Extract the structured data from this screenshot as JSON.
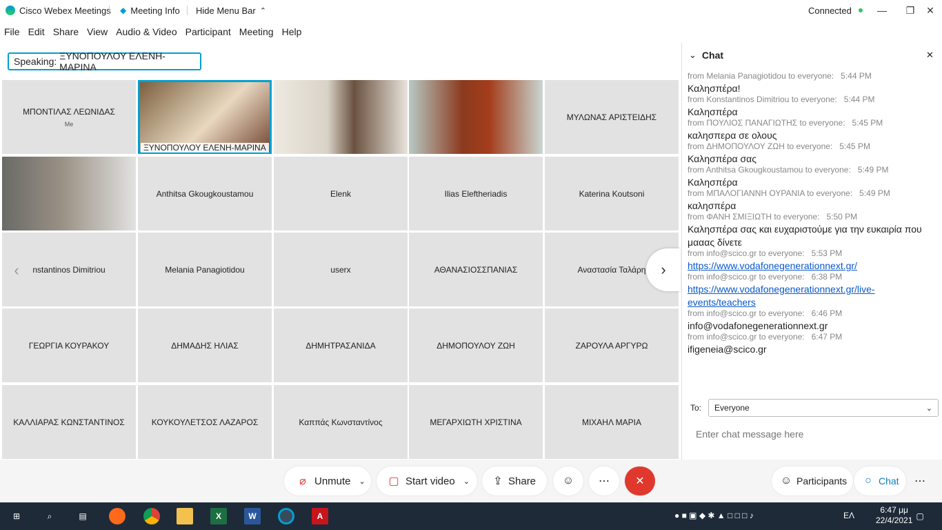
{
  "titlebar": {
    "app_name": "Cisco Webex Meetings",
    "meeting_info": "Meeting Info",
    "hide_menu": "Hide Menu Bar",
    "status": "Connected"
  },
  "menu": [
    "File",
    "Edit",
    "Share",
    "View",
    "Audio & Video",
    "Participant",
    "Meeting",
    "Help"
  ],
  "speaking": {
    "label": "Speaking:",
    "name": "ΞΥΝΟΠΟΥΛΟΥ ΕΛΕΝΗ-ΜΑΡΙΝΑ"
  },
  "tiles": [
    {
      "name": "ΜΠΟΝΤΙΛΑΣ ΛΕΩΝΙΔΑΣ",
      "sub": "Me"
    },
    {
      "name": "ΞΥΝΟΠΟΥΛΟΥ ΕΛΕΝΗ-ΜΑΡΙΝΑ",
      "video": true,
      "active": true
    },
    {
      "name": "",
      "video": true
    },
    {
      "name": "",
      "video": true
    },
    {
      "name": "ΜΥΛΩΝΑΣ ΑΡΙΣΤΕΙΔΗΣ"
    },
    {
      "name": "",
      "video": true
    },
    {
      "name": "Anthitsa Gkougkoustamou"
    },
    {
      "name": "Elenk"
    },
    {
      "name": "Ilias Eleftheriadis"
    },
    {
      "name": "Katerina Koutsoni"
    },
    {
      "name": "nstantinos Dimitriou"
    },
    {
      "name": "Melania Panagiotidou"
    },
    {
      "name": "userx"
    },
    {
      "name": "ΑΘΑΝΑΣΙΟΣΣΠΑΝΙΑΣ"
    },
    {
      "name": "Αναστασία Ταλάρη"
    },
    {
      "name": "ΓΕΩΡΓΙΑ ΚΟΥΡΑΚΟΥ"
    },
    {
      "name": "ΔΗΜΑΔΗΣ ΗΛΙΑΣ"
    },
    {
      "name": "ΔΗΜΗΤΡΑΣΑΝΙΔΑ"
    },
    {
      "name": "ΔΗΜΟΠΟΥΛΟΥ ΖΩΗ"
    },
    {
      "name": "ΖΑΡΟΥΛΑ ΑΡΓΥΡΩ"
    },
    {
      "name": "ΚΑΛΛΙΑΡΑΣ ΚΩΝΣΤΑΝΤΙΝΟΣ"
    },
    {
      "name": "ΚΟΥΚΟΥΛΕΤΣΟΣ ΛΑΖΑΡΟΣ"
    },
    {
      "name": "Καππάς Κωνσταντίνος"
    },
    {
      "name": "ΜΕΓΑΡΧΙΩΤΗ ΧΡΙΣΤΙΝΑ"
    },
    {
      "name": "ΜΙΧΑΗΛ ΜΑΡΙΑ"
    }
  ],
  "chat": {
    "title": "Chat",
    "messages": [
      {
        "meta": "from Melania Panagiotidou to everyone:",
        "time": "5:44 PM",
        "text": "Καλησπέρα!"
      },
      {
        "meta": "from Konstantinos Dimitriou to everyone:",
        "time": "5:44 PM",
        "text": "Καλησπέρα"
      },
      {
        "meta": "from ΠΟΥΛΙΟΣ ΠΑΝΑΓΙΩΤΗΣ to everyone:",
        "time": "5:45 PM",
        "text": "καλησπερα σε ολους"
      },
      {
        "meta": "from ΔΗΜΟΠΟΥΛΟΥ ΖΩΗ to everyone:",
        "time": "5:45 PM",
        "text": "Καλησπέρα σας"
      },
      {
        "meta": "from Anthitsa Gkougkoustamou to everyone:",
        "time": "5:49 PM",
        "text": "Καλησπέρα"
      },
      {
        "meta": "from ΜΠΑΛΟΓΙΑΝΝΗ ΟΥΡΑΝΙΑ to everyone:",
        "time": "5:49 PM",
        "text": "καλησπέρα"
      },
      {
        "meta": "from ΦΑΝΗ ΣΜΙΞΙΩΤΗ to everyone:",
        "time": "5:50 PM",
        "text": "Καλησπέρα σας και ευχαριστούμε για την ευκαιρία που μααας δίνετε"
      },
      {
        "meta": "from info@scico.gr to everyone:",
        "time": "5:53 PM",
        "text": "https://www.vodafonegenerationnext.gr/",
        "link": true
      },
      {
        "meta": "from info@scico.gr to everyone:",
        "time": "6:38 PM",
        "text": "https://www.vodafonegenerationnext.gr/live-events/teachers",
        "link": true
      },
      {
        "meta": "from info@scico.gr to everyone:",
        "time": "6:46 PM",
        "text": "info@vodafonegenerationnext.gr"
      },
      {
        "meta": "from info@scico.gr to everyone:",
        "time": "6:47 PM",
        "text": "ifigeneia@scico.gr"
      }
    ],
    "to_label": "To:",
    "to_value": "Everyone",
    "input_placeholder": "Enter chat message here"
  },
  "controls": {
    "unmute": "Unmute",
    "start_video": "Start video",
    "share": "Share",
    "participants": "Participants",
    "chat": "Chat"
  },
  "taskbar": {
    "language": "ΕΛ",
    "time": "6:47 μμ",
    "date": "22/4/2021"
  },
  "colors": {
    "accent": "#00a0d1",
    "end_call": "#e0382d",
    "taskbar": "#1e2a38"
  }
}
